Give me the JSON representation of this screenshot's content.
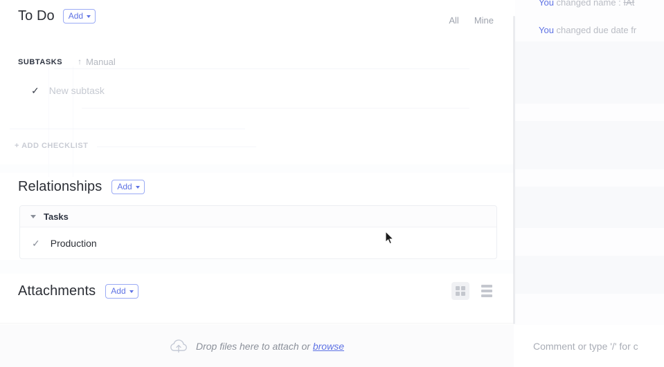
{
  "main": {
    "todo": {
      "title": "To Do",
      "add_label": "Add"
    },
    "filters": [
      {
        "label": "All"
      },
      {
        "label": "Mine"
      }
    ],
    "subtasks": {
      "label": "SUBTASKS",
      "sort_arrow": "↑",
      "sort_label": "Manual",
      "new_subtask_placeholder": "New subtask",
      "new_subtask_check": "✓",
      "add_checklist_label": "+ ADD CHECKLIST"
    },
    "relationships": {
      "title": "Relationships",
      "add_label": "Add",
      "group": {
        "label": "Tasks",
        "items": [
          {
            "check": "✓",
            "label": "Production"
          }
        ]
      }
    },
    "attachments": {
      "title": "Attachments",
      "add_label": "Add",
      "views": [
        {
          "name": "grid-view",
          "active": true
        },
        {
          "name": "list-view",
          "active": false
        }
      ]
    },
    "dropzone": {
      "icon": "cloud-upload-icon",
      "text": "Drop files here to attach or ",
      "browse_label": "browse"
    }
  },
  "activity": {
    "items": [
      {
        "who": "You",
        "action": " changed name : ",
        "value": "IAt"
      },
      {
        "who": "You",
        "action": " changed due date fr",
        "value": ""
      }
    ]
  },
  "comment": {
    "placeholder": "Comment or type '/' for c"
  },
  "colors": {
    "accent": "#5e72e4",
    "text_primary": "#2b2e35",
    "text_muted": "#9ea3ad",
    "border": "#eceef2",
    "panel_bg": "#ffffff",
    "dropzone_bg": "#fbfbfc"
  }
}
